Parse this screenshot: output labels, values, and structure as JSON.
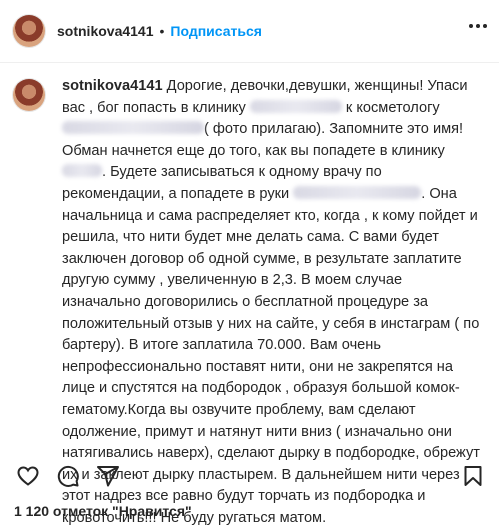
{
  "header": {
    "username": "sotnikova4141",
    "dot": "•",
    "follow_label": "Подписаться",
    "more_icon": "more-horizontal-icon"
  },
  "comment": {
    "username": "sotnikova4141",
    "text_parts": [
      " Дорогие, девочки,девушки, женщины! Упаси вас , бог попасть в клинику ",
      " к косметологу ",
      "( фото прилагаю). Запомните это имя! Обман начнется еще до того, как вы попадете в клинику ",
      ". Будете записываться к одному врачу по рекомендации, а попадете в руки ",
      ". Она начальница и сама распределяет кто, когда , к кому пойдет и решила, что нити будет мне делать сама. С вами будет заключен договор об одной сумме, в результате заплатите другую сумму , увеличенную в 2,3. В моем случае изначально договорились о бесплатной процедуре за положительный отзыв у них на сайте, у себя в инстаграм ( по бартеру). В итоге заплатила 70.000. Вам очень непрофессионально поставят нити, они не закрепятся на лице и спустятся на подбородок , образуя большой комок-гематому.Когда вы озвучите проблему, вам сделают одолжение, примут и натянут нити вниз ( изначально они натягивались наверх), сделают дырку в подбородке, обрежут их и заклеют дырку пластырем. В дальнейшем нити через этот надрез все равно будут торчать из подбородка и кровоточить!!! Не буду ругаться матом."
    ]
  },
  "footer": {
    "icons": [
      "heart-icon",
      "comment-icon",
      "share-icon",
      "bookmark-icon"
    ],
    "likes_text": "1 120 отметок \"Нравится\""
  }
}
